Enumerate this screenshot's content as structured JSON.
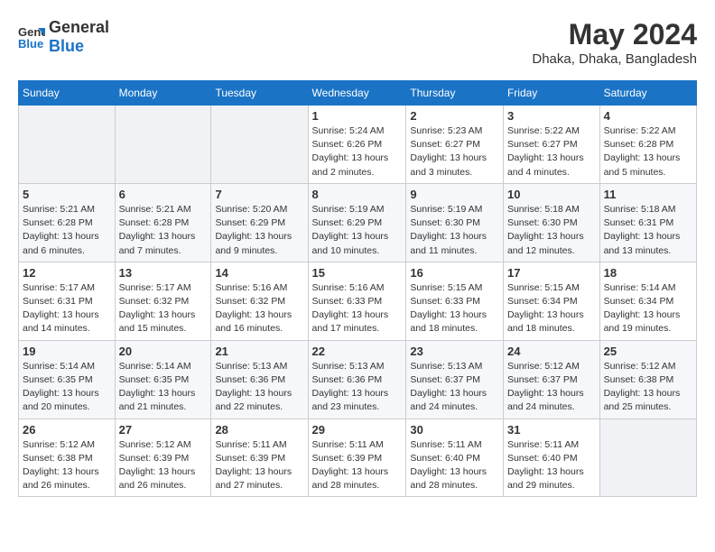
{
  "header": {
    "logo_line1": "General",
    "logo_line2": "Blue",
    "month_year": "May 2024",
    "location": "Dhaka, Dhaka, Bangladesh"
  },
  "days_of_week": [
    "Sunday",
    "Monday",
    "Tuesday",
    "Wednesday",
    "Thursday",
    "Friday",
    "Saturday"
  ],
  "weeks": [
    [
      {
        "day": "",
        "info": ""
      },
      {
        "day": "",
        "info": ""
      },
      {
        "day": "",
        "info": ""
      },
      {
        "day": "1",
        "info": "Sunrise: 5:24 AM\nSunset: 6:26 PM\nDaylight: 13 hours and 2 minutes."
      },
      {
        "day": "2",
        "info": "Sunrise: 5:23 AM\nSunset: 6:27 PM\nDaylight: 13 hours and 3 minutes."
      },
      {
        "day": "3",
        "info": "Sunrise: 5:22 AM\nSunset: 6:27 PM\nDaylight: 13 hours and 4 minutes."
      },
      {
        "day": "4",
        "info": "Sunrise: 5:22 AM\nSunset: 6:28 PM\nDaylight: 13 hours and 5 minutes."
      }
    ],
    [
      {
        "day": "5",
        "info": "Sunrise: 5:21 AM\nSunset: 6:28 PM\nDaylight: 13 hours and 6 minutes."
      },
      {
        "day": "6",
        "info": "Sunrise: 5:21 AM\nSunset: 6:28 PM\nDaylight: 13 hours and 7 minutes."
      },
      {
        "day": "7",
        "info": "Sunrise: 5:20 AM\nSunset: 6:29 PM\nDaylight: 13 hours and 9 minutes."
      },
      {
        "day": "8",
        "info": "Sunrise: 5:19 AM\nSunset: 6:29 PM\nDaylight: 13 hours and 10 minutes."
      },
      {
        "day": "9",
        "info": "Sunrise: 5:19 AM\nSunset: 6:30 PM\nDaylight: 13 hours and 11 minutes."
      },
      {
        "day": "10",
        "info": "Sunrise: 5:18 AM\nSunset: 6:30 PM\nDaylight: 13 hours and 12 minutes."
      },
      {
        "day": "11",
        "info": "Sunrise: 5:18 AM\nSunset: 6:31 PM\nDaylight: 13 hours and 13 minutes."
      }
    ],
    [
      {
        "day": "12",
        "info": "Sunrise: 5:17 AM\nSunset: 6:31 PM\nDaylight: 13 hours and 14 minutes."
      },
      {
        "day": "13",
        "info": "Sunrise: 5:17 AM\nSunset: 6:32 PM\nDaylight: 13 hours and 15 minutes."
      },
      {
        "day": "14",
        "info": "Sunrise: 5:16 AM\nSunset: 6:32 PM\nDaylight: 13 hours and 16 minutes."
      },
      {
        "day": "15",
        "info": "Sunrise: 5:16 AM\nSunset: 6:33 PM\nDaylight: 13 hours and 17 minutes."
      },
      {
        "day": "16",
        "info": "Sunrise: 5:15 AM\nSunset: 6:33 PM\nDaylight: 13 hours and 18 minutes."
      },
      {
        "day": "17",
        "info": "Sunrise: 5:15 AM\nSunset: 6:34 PM\nDaylight: 13 hours and 18 minutes."
      },
      {
        "day": "18",
        "info": "Sunrise: 5:14 AM\nSunset: 6:34 PM\nDaylight: 13 hours and 19 minutes."
      }
    ],
    [
      {
        "day": "19",
        "info": "Sunrise: 5:14 AM\nSunset: 6:35 PM\nDaylight: 13 hours and 20 minutes."
      },
      {
        "day": "20",
        "info": "Sunrise: 5:14 AM\nSunset: 6:35 PM\nDaylight: 13 hours and 21 minutes."
      },
      {
        "day": "21",
        "info": "Sunrise: 5:13 AM\nSunset: 6:36 PM\nDaylight: 13 hours and 22 minutes."
      },
      {
        "day": "22",
        "info": "Sunrise: 5:13 AM\nSunset: 6:36 PM\nDaylight: 13 hours and 23 minutes."
      },
      {
        "day": "23",
        "info": "Sunrise: 5:13 AM\nSunset: 6:37 PM\nDaylight: 13 hours and 24 minutes."
      },
      {
        "day": "24",
        "info": "Sunrise: 5:12 AM\nSunset: 6:37 PM\nDaylight: 13 hours and 24 minutes."
      },
      {
        "day": "25",
        "info": "Sunrise: 5:12 AM\nSunset: 6:38 PM\nDaylight: 13 hours and 25 minutes."
      }
    ],
    [
      {
        "day": "26",
        "info": "Sunrise: 5:12 AM\nSunset: 6:38 PM\nDaylight: 13 hours and 26 minutes."
      },
      {
        "day": "27",
        "info": "Sunrise: 5:12 AM\nSunset: 6:39 PM\nDaylight: 13 hours and 26 minutes."
      },
      {
        "day": "28",
        "info": "Sunrise: 5:11 AM\nSunset: 6:39 PM\nDaylight: 13 hours and 27 minutes."
      },
      {
        "day": "29",
        "info": "Sunrise: 5:11 AM\nSunset: 6:39 PM\nDaylight: 13 hours and 28 minutes."
      },
      {
        "day": "30",
        "info": "Sunrise: 5:11 AM\nSunset: 6:40 PM\nDaylight: 13 hours and 28 minutes."
      },
      {
        "day": "31",
        "info": "Sunrise: 5:11 AM\nSunset: 6:40 PM\nDaylight: 13 hours and 29 minutes."
      },
      {
        "day": "",
        "info": ""
      }
    ]
  ]
}
